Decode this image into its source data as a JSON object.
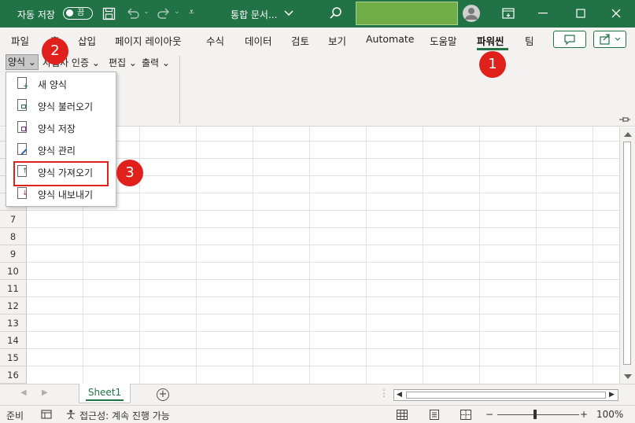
{
  "titlebar": {
    "autosave_label": "자동 저장",
    "autosave_state": "끔",
    "doc_title": "통합 문서...",
    "colors": {
      "bar": "#217346",
      "highlight": "#70ad47"
    }
  },
  "ribbon": {
    "tabs": [
      "파일",
      "홈",
      "삽입",
      "페이지 레이아웃",
      "수식",
      "데이터",
      "검토",
      "보기",
      "Automate",
      "도움말",
      "파워씬",
      "팀"
    ],
    "active_tab": "파워씬",
    "group_buttons": [
      "양식",
      "사업자 인증",
      "편집",
      "출력"
    ]
  },
  "menu": {
    "items": [
      "새 양식",
      "양식 불러오기",
      "양식 저장",
      "양식 관리",
      "양식 가져오기",
      "양식 내보내기"
    ],
    "icons": [
      "new-doc-icon",
      "open-doc-icon",
      "save-doc-icon",
      "edit-doc-icon",
      "import-doc-icon",
      "export-doc-icon"
    ]
  },
  "grid": {
    "row_labels": [
      "7",
      "8",
      "9",
      "10",
      "11",
      "12",
      "13",
      "14",
      "15",
      "16"
    ]
  },
  "sheets": {
    "tabs": [
      "Sheet1"
    ],
    "active": "Sheet1"
  },
  "status": {
    "ready": "준비",
    "accessibility": "접근성: 계속 진행 가능",
    "zoom": "100%",
    "zoom_minus": "−",
    "zoom_plus": "+"
  },
  "annotations": {
    "badges": [
      "1",
      "2",
      "3"
    ],
    "color": "#e0201b"
  }
}
